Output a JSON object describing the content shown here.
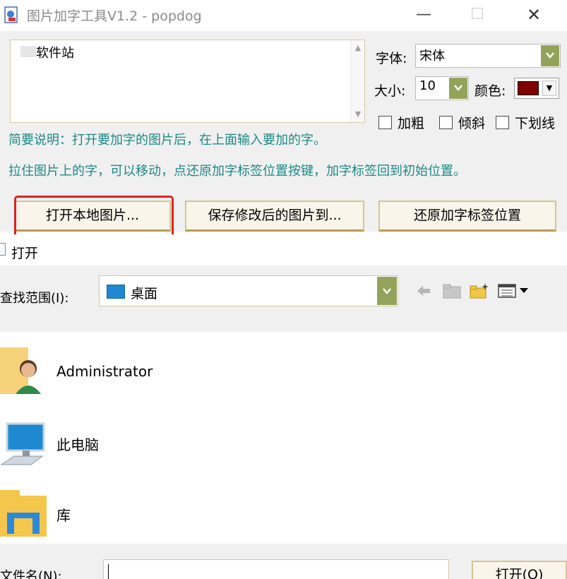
{
  "app": {
    "title": "图片加字工具V1.2 - popdog",
    "text_content": "软件站",
    "font_label": "字体:",
    "font_value": "宋体",
    "size_label": "大小:",
    "size_value": "10",
    "color_label": "颜色:",
    "color_value": "#800000",
    "bold_label": "加粗",
    "italic_label": "倾斜",
    "underline_label": "下划线",
    "hint_line1": "简要说明：打开要加字的图片后，在上面输入要加的字。",
    "hint_line2": "拉住图片上的字，可以移动，点还原加字标签位置按键，加字标签回到初始位置。",
    "open_button": "打开本地图片...",
    "save_button": "保存修改后的图片到...",
    "restore_button": "还原加字标签位置",
    "highlight_color": "#e02020",
    "accent_color": "#94a35a",
    "hint_color": "#1c8a86"
  },
  "dialog": {
    "title": "打开",
    "lookin_label": "查找范围(I):",
    "lookin_value": "桌面",
    "toolbar_icons": [
      "back-arrow-icon",
      "up-folder-icon",
      "new-folder-icon",
      "view-menu-icon"
    ],
    "items": [
      {
        "name": "Administrator",
        "icon": "user-folder-icon"
      },
      {
        "name": "此电脑",
        "icon": "computer-icon"
      },
      {
        "name": "库",
        "icon": "library-folder-icon"
      }
    ],
    "filename_label": "文件名(N):",
    "filename_value": "",
    "open_button": "打开(O)"
  }
}
